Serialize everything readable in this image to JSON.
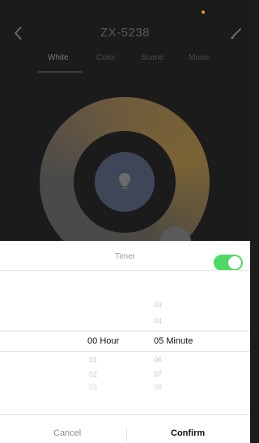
{
  "header": {
    "title": "ZX-5238"
  },
  "tabs": [
    "White",
    "Color",
    "Scene",
    "Music"
  ],
  "timer": {
    "label": "Timer",
    "enabled": true,
    "hour": {
      "above": [
        "",
        ""
      ],
      "selected_value": "00",
      "unit": "Hour",
      "below": [
        "01",
        "02",
        "03"
      ]
    },
    "minute": {
      "above": [
        "03",
        "04"
      ],
      "selected_value": "05",
      "unit": "Minute",
      "below": [
        "06",
        "07",
        "08"
      ]
    }
  },
  "actions": {
    "cancel": "Cancel",
    "confirm": "Confirm"
  },
  "colors": {
    "toggle_on": "#4cd964",
    "app_background": "#1b1b1b",
    "accent_dot": "#e59a2d"
  }
}
